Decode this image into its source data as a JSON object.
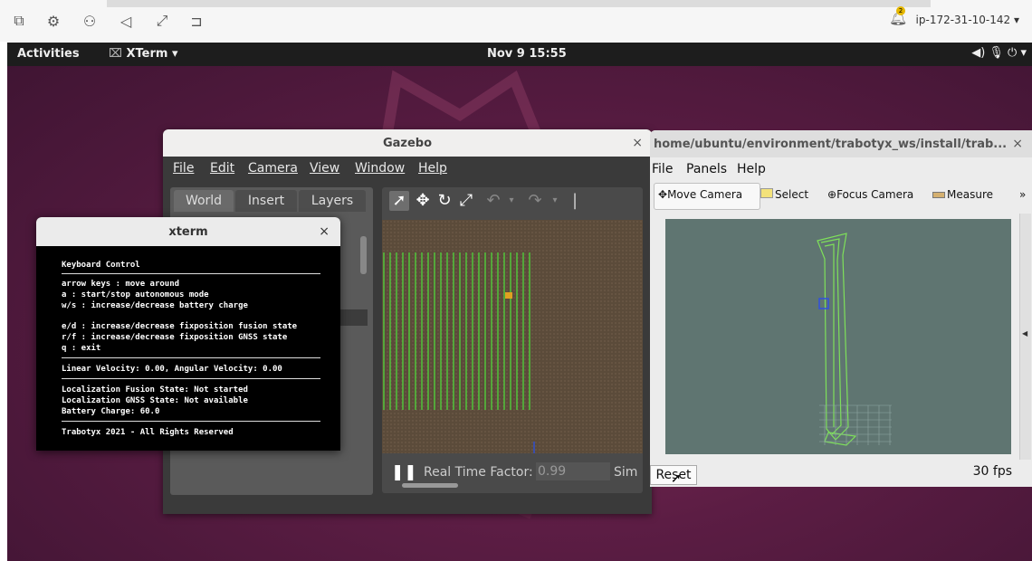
{
  "remote_toolbar": {
    "icons": [
      "window-icon",
      "settings-icon",
      "user-icon",
      "speaker-icon",
      "fullscreen-icon",
      "display-icon"
    ],
    "notification_count": "2",
    "host": "ip-172-31-10-142 ▾"
  },
  "top_bar": {
    "activities": "Activities",
    "app": "XTerm ▾",
    "clock": "Nov 9  15:55",
    "system": "◀)  🎙  ⏻ ▾"
  },
  "gazebo": {
    "title": "Gazebo",
    "close": "×",
    "menu": [
      "File",
      "Edit",
      "Camera",
      "View",
      "Window",
      "Help"
    ],
    "tabs": [
      "World",
      "Insert",
      "Layers"
    ],
    "status_label": "Real Time Factor:",
    "status_value": "0.99",
    "sim_label": "Sim"
  },
  "rviz": {
    "title": "home/ubuntu/environment/trabotyx_ws/install/trab...",
    "close": "×",
    "menu": [
      "File",
      "Panels",
      "Help"
    ],
    "tools": [
      "Move Camera",
      "Select",
      "Focus Camera",
      "Measure"
    ],
    "more": "»",
    "reset": "Reset",
    "fps": "30 fps"
  },
  "xterm": {
    "title": "xterm",
    "close": "×",
    "lines": [
      "Keyboard Control",
      "arrow keys : move around",
      "a : start/stop autonomous mode",
      "w/s : increase/decrease battery charge",
      "e/d : increase/decrease fixposition fusion state",
      "r/f : increase/decrease fixposition GNSS state",
      "q : exit",
      "Linear Velocity: 0.00, Angular Velocity: 0.00",
      "Localization Fusion State: Not started",
      "Localization GNSS State: Not available",
      "Battery Charge: 60.0",
      "Trabotyx 2021 - All Rights Reserved"
    ]
  }
}
